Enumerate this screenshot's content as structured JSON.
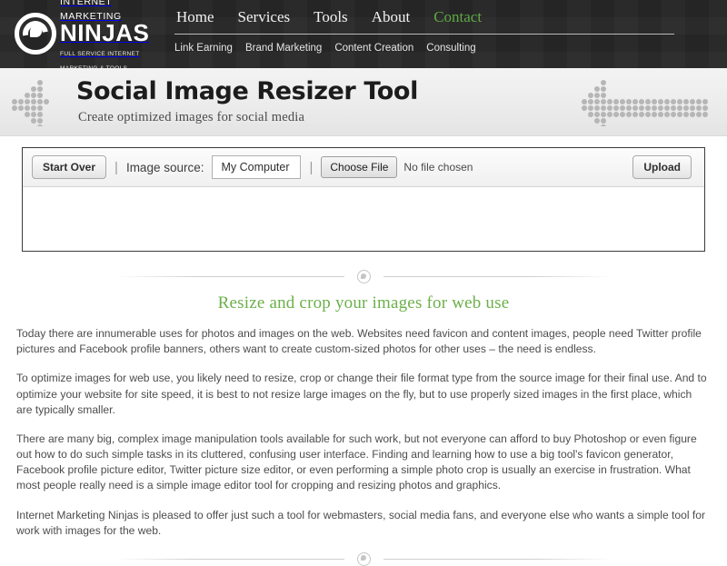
{
  "header": {
    "logo": {
      "icon": "ninja-swirl-icon",
      "line1": "INTERNET MARKETING",
      "line2": "NINJAS",
      "tagline": "FULL SERVICE INTERNET MARKETING & TOOLS"
    },
    "primary_nav": [
      {
        "label": "Home",
        "accent": false
      },
      {
        "label": "Services",
        "accent": false
      },
      {
        "label": "Tools",
        "accent": false
      },
      {
        "label": "About",
        "accent": false
      },
      {
        "label": "Contact",
        "accent": true
      }
    ],
    "secondary_nav": [
      {
        "label": "Link Earning"
      },
      {
        "label": "Brand Marketing"
      },
      {
        "label": "Content Creation"
      },
      {
        "label": "Consulting"
      }
    ],
    "accent_color": "#5fa845",
    "background_color": "#252525"
  },
  "banner": {
    "title": "Social Image Resizer Tool",
    "subtitle": "Create optimized images for social media",
    "left_decoration": "dot-arrow-right-icon",
    "right_decoration": "dot-arrow-left-icon"
  },
  "toolbar": {
    "start_over_label": "Start Over",
    "separator": "|",
    "image_source_label": "Image source:",
    "image_source_value": "My Computer",
    "choose_file_label": "Choose File",
    "file_status": "No file chosen",
    "upload_label": "Upload"
  },
  "content": {
    "divider_icon": "ninja-swirl-icon",
    "heading": "Resize and crop your images for web use",
    "heading_color": "#6cb04a",
    "paragraphs": [
      "Today there are innumerable uses for photos and images on the web. Websites need favicon and content images, people need Twitter profile pictures and Facebook profile banners, others want to create custom-sized photos for other uses – the need is endless.",
      "To optimize images for web use, you likely need to resize, crop or change their file format type from the source image for their final use. And to optimize your website for site speed, it is best to not resize large images on the fly, but to use properly sized images in the first place, which are typically smaller.",
      "There are many big, complex image manipulation tools available for such work, but not everyone can afford to buy Photoshop or even figure out how to do such simple tasks in its cluttered, confusing user interface. Finding and learning how to use a big tool's favicon generator, Facebook profile picture editor, Twitter picture size editor, or even performing a simple photo crop is usually an exercise in frustration. What most people really need is a simple image editor tool for cropping and resizing photos and graphics.",
      "Internet Marketing Ninjas is pleased to offer just such a tool for webmasters, social media fans, and everyone else who wants a simple tool for work with images for the web."
    ]
  }
}
